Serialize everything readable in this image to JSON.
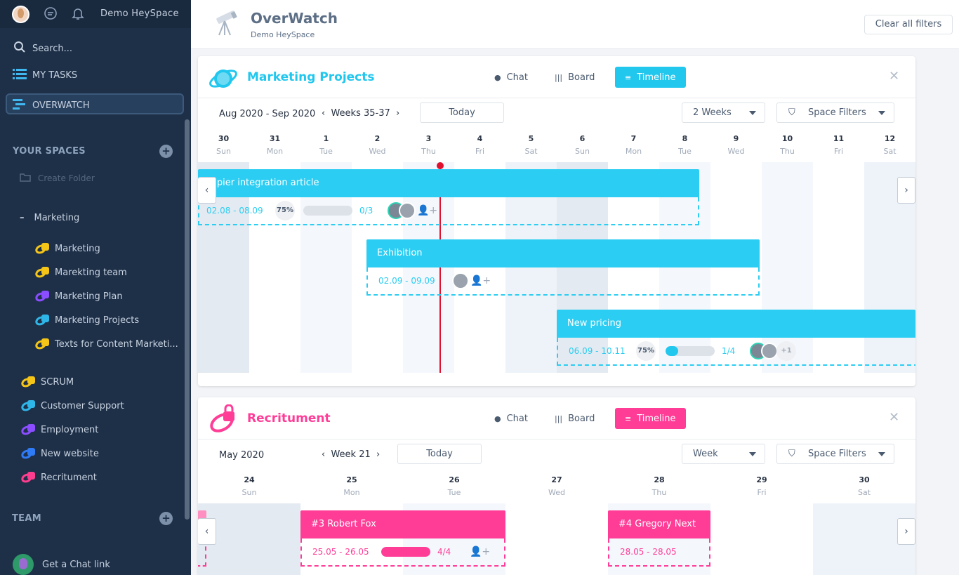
{
  "sidebar": {
    "workspace_name": "Demo HeySpace",
    "search_label": "Search...",
    "my_tasks_label": "MY TASKS",
    "overwatch_label": "OVERWATCH",
    "your_spaces_label": "YOUR SPACES",
    "create_folder_label": "Create Folder",
    "folder_name": "Marketing",
    "folder_spaces": [
      {
        "label": "Marketing",
        "color": "#f5c518"
      },
      {
        "label": "Marekting team",
        "color": "#f5c518"
      },
      {
        "label": "Marketing Plan",
        "color": "#8a4dff"
      },
      {
        "label": "Marketing Projects",
        "color": "#2fb6e8"
      },
      {
        "label": "Texts for Content Marketi...",
        "color": "#f5c518"
      }
    ],
    "spaces": [
      {
        "label": "SCRUM",
        "color": "#f5c518"
      },
      {
        "label": "Customer Support",
        "color": "#2fb6e8"
      },
      {
        "label": "Employment",
        "color": "#8a4dff"
      },
      {
        "label": "New website",
        "color": "#2f7bf5"
      },
      {
        "label": "Recritument",
        "color": "#ff3d8f"
      }
    ],
    "team_label": "TEAM",
    "chat_link_label": "Get a Chat link"
  },
  "header": {
    "title": "OverWatch",
    "subtitle": "Demo HeySpace",
    "clear_filters_label": "Clear all filters"
  },
  "tabs": {
    "chat": "Chat",
    "board": "Board",
    "timeline": "Timeline"
  },
  "marketing": {
    "title": "Marketing Projects",
    "accent": "#22c7ee",
    "date_range": "Aug 2020 - Sep 2020",
    "weeks_label": "Weeks 35-37",
    "today_label": "Today",
    "period_select": "2 Weeks",
    "space_filters": "Space Filters",
    "days": [
      {
        "num": "30",
        "name": "Sun"
      },
      {
        "num": "31",
        "name": "Mon"
      },
      {
        "num": "1",
        "name": "Tue"
      },
      {
        "num": "2",
        "name": "Wed"
      },
      {
        "num": "3",
        "name": "Thu"
      },
      {
        "num": "4",
        "name": "Fri"
      },
      {
        "num": "5",
        "name": "Sat"
      },
      {
        "num": "6",
        "name": "Sun"
      },
      {
        "num": "7",
        "name": "Mon"
      },
      {
        "num": "8",
        "name": "Tue"
      },
      {
        "num": "9",
        "name": "Wed"
      },
      {
        "num": "10",
        "name": "Thu"
      },
      {
        "num": "11",
        "name": "Fri"
      },
      {
        "num": "12",
        "name": "Sat"
      }
    ],
    "tasks": [
      {
        "title": "Zapier integration article",
        "dates": "02.08 - 08.09",
        "percent": "75%",
        "progress": 0,
        "count": "0/3"
      },
      {
        "title": "Exhibition",
        "dates": "02.09 - 09.09"
      },
      {
        "title": "New pricing",
        "dates": "06.09 - 10.11",
        "percent": "75%",
        "progress": 0.25,
        "count": "1/4",
        "extra": "+1"
      }
    ]
  },
  "recruitment": {
    "title": "Recritument",
    "accent": "#ff3d97",
    "date_range": "May 2020",
    "weeks_label": "Week 21",
    "today_label": "Today",
    "period_select": "Week",
    "space_filters": "Space Filters",
    "days": [
      {
        "num": "24",
        "name": "Sun"
      },
      {
        "num": "25",
        "name": "Mon"
      },
      {
        "num": "26",
        "name": "Tue"
      },
      {
        "num": "27",
        "name": "Wed"
      },
      {
        "num": "28",
        "name": "Thu"
      },
      {
        "num": "29",
        "name": "Fri"
      },
      {
        "num": "30",
        "name": "Sat"
      }
    ],
    "tasks": [
      {
        "title": "#3 Robert Fox",
        "dates": "25.05 - 26.05",
        "count": "4/4",
        "progress": 1
      },
      {
        "title": "#4 Gregory Next",
        "dates": "28.05 - 28.05"
      }
    ]
  }
}
